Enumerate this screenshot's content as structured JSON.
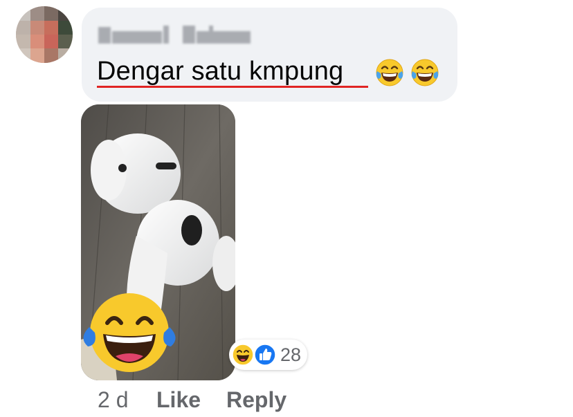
{
  "comment": {
    "text": "Dengar satu kmpung",
    "emojis": [
      "face-with-tears-of-joy",
      "face-with-tears-of-joy"
    ]
  },
  "reactions": {
    "icons": [
      "laughing-face",
      "like-thumbs-up"
    ],
    "count": "28"
  },
  "meta": {
    "time": "2 d",
    "like_label": "Like",
    "reply_label": "Reply"
  },
  "colors": {
    "bubble": "#f0f2f5",
    "text": "#050505",
    "meta_text": "#65676b",
    "like_blue": "#1877f2",
    "emoji_yellow": "#f8c92c",
    "spell_underline": "#e02424"
  }
}
